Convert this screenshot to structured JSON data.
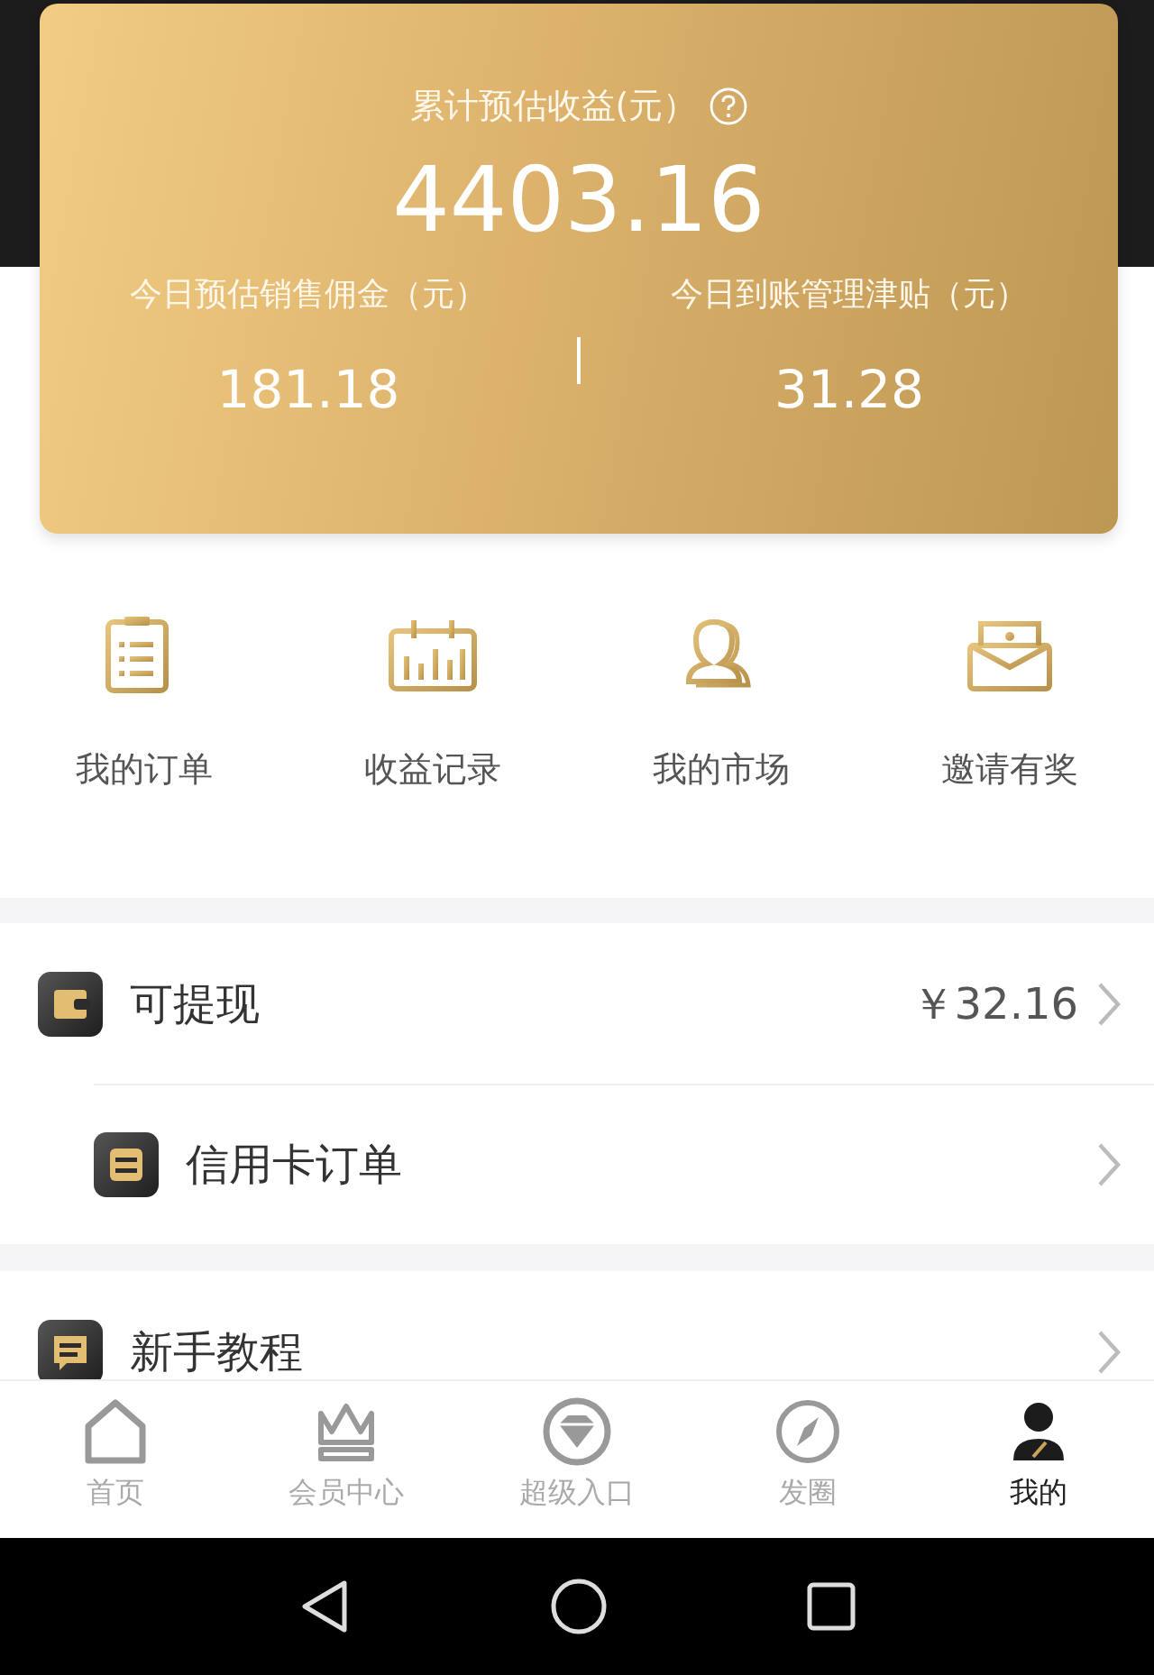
{
  "earnings_card": {
    "title": "累计预估收益(元）",
    "total": "4403.16",
    "columns": [
      {
        "label": "今日预估销售佣金（元）",
        "value": "181.18"
      },
      {
        "label": "今日到账管理津贴（元）",
        "value": "31.28"
      }
    ]
  },
  "shortcuts": [
    {
      "kind": "clipboard",
      "label": "我的订单"
    },
    {
      "kind": "calendar",
      "label": "收益记录"
    },
    {
      "kind": "people",
      "label": "我的市场"
    },
    {
      "kind": "envelope",
      "label": "邀请有奖"
    }
  ],
  "list_groups": [
    [
      {
        "kind": "wallet",
        "label": "可提现",
        "value": "￥32.16"
      },
      {
        "kind": "card",
        "label": "信用卡订单"
      }
    ],
    [
      {
        "kind": "chat",
        "label": "新手教程"
      }
    ]
  ],
  "tab_bar": [
    {
      "kind": "home",
      "label": "首页",
      "selected": false
    },
    {
      "kind": "crown",
      "label": "会员中心",
      "selected": false
    },
    {
      "kind": "diamond",
      "label": "超级入口",
      "selected": false
    },
    {
      "kind": "compass",
      "label": "发圈",
      "selected": false
    },
    {
      "kind": "person",
      "label": "我的",
      "selected": true
    }
  ]
}
